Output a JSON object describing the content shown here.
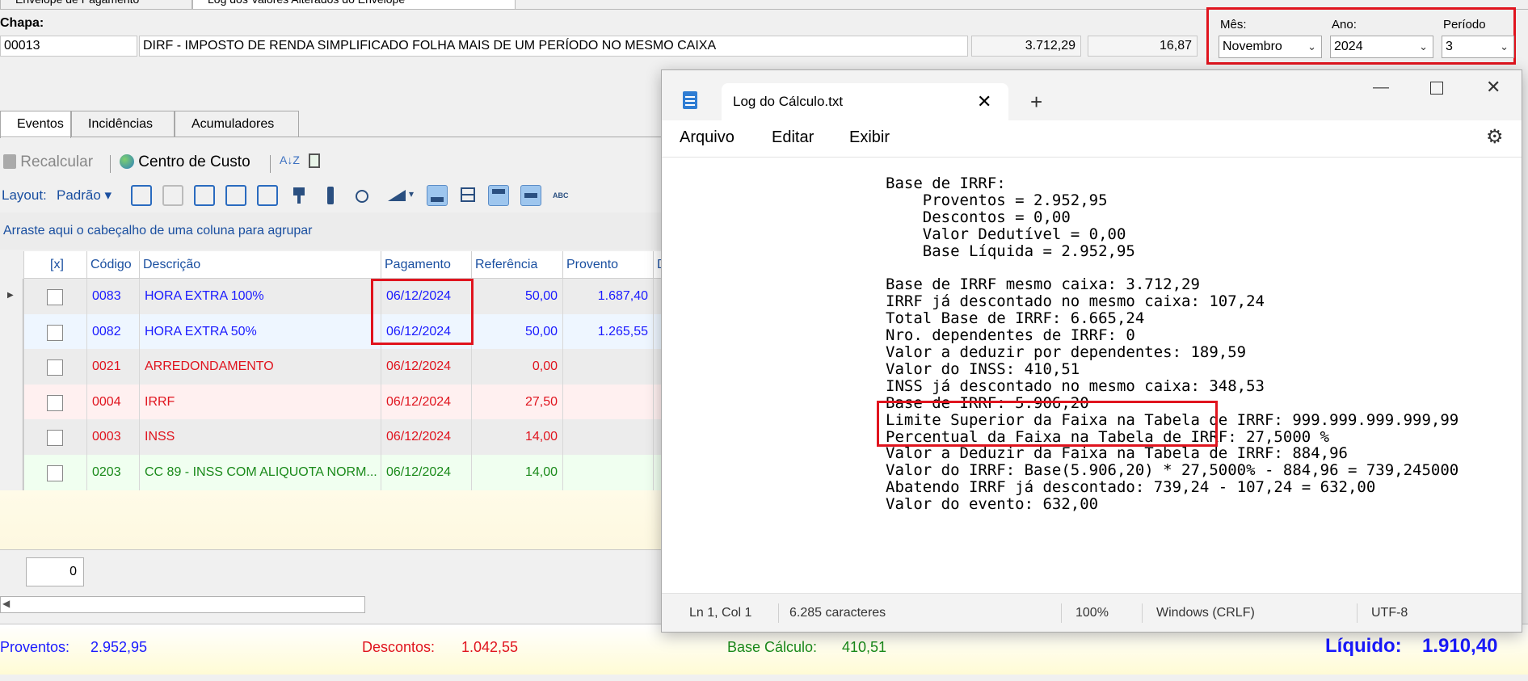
{
  "top_tabs": [
    "Envelope de Pagamento",
    "Log dos Valores Alterados do Envelope"
  ],
  "chapa": {
    "label": "Chapa:",
    "code": "00013",
    "description": "DIRF - IMPOSTO DE RENDA SIMPLIFICADO FOLHA MAIS DE UM PERÍODO NO MESMO CAIXA",
    "value1": "3.712,29",
    "value2": "16,87"
  },
  "period": {
    "mes_label": "Mês:",
    "mes_value": "Novembro",
    "ano_label": "Ano:",
    "ano_value": "2024",
    "periodo_label": "Período",
    "periodo_value": "3"
  },
  "tabs": [
    "Eventos",
    "Incidências",
    "Acumuladores"
  ],
  "toolbar": {
    "recalcular": "Recalcular",
    "centro_custo": "Centro de Custo"
  },
  "layout": {
    "label": "Layout:",
    "value": "Padrão"
  },
  "group_hint": "Arraste aqui o cabeçalho de uma coluna para agrupar",
  "grid": {
    "headers": [
      "[x]",
      "Código",
      "Descrição",
      "Pagamento",
      "Referência",
      "Provento",
      "D"
    ],
    "rows": [
      {
        "codigo": "0083",
        "descricao": "HORA EXTRA 100%",
        "pagamento": "06/12/2024",
        "referencia": "50,00",
        "provento": "1.687,40",
        "color": "#1a1aff",
        "bg": "#ececec"
      },
      {
        "codigo": "0082",
        "descricao": "HORA EXTRA 50%",
        "pagamento": "06/12/2024",
        "referencia": "50,00",
        "provento": "1.265,55",
        "color": "#1a1aff",
        "bg": "#eef6ff"
      },
      {
        "codigo": "0021",
        "descricao": "ARREDONDAMENTO",
        "pagamento": "06/12/2024",
        "referencia": "0,00",
        "provento": "",
        "color": "#e0141e",
        "bg": "#ececec"
      },
      {
        "codigo": "0004",
        "descricao": "IRRF",
        "pagamento": "06/12/2024",
        "referencia": "27,50",
        "provento": "",
        "color": "#e0141e",
        "bg": "#fff0f0"
      },
      {
        "codigo": "0003",
        "descricao": "INSS",
        "pagamento": "06/12/2024",
        "referencia": "14,00",
        "provento": "",
        "color": "#e0141e",
        "bg": "#ececec"
      },
      {
        "codigo": "0203",
        "descricao": "CC 89 - INSS COM ALIQUOTA NORM...",
        "pagamento": "06/12/2024",
        "referencia": "14,00",
        "provento": "",
        "color": "#1a8a1a",
        "bg": "#f0fff0"
      }
    ]
  },
  "count_value": "0",
  "footer": {
    "proventos_label": "Proventos:",
    "proventos_value": "2.952,95",
    "descontos_label": "Descontos:",
    "descontos_value": "1.042,55",
    "base_label": "Base Cálculo:",
    "base_value": "410,51",
    "liquido_label": "Líquido:",
    "liquido_value": "1.910,40"
  },
  "notepad": {
    "tab_title": "Log do Cálculo.txt",
    "menu": [
      "Arquivo",
      "Editar",
      "Exibir"
    ],
    "lines": [
      "Base de IRRF:",
      "    Proventos = 2.952,95",
      "    Descontos = 0,00",
      "    Valor Dedutível = 0,00",
      "    Base Líquida = 2.952,95",
      "",
      "Base de IRRF mesmo caixa: 3.712,29",
      "IRRF já descontado no mesmo caixa: 107,24",
      "Total Base de IRRF: 6.665,24",
      "Nro. dependentes de IRRF: 0",
      "Valor a deduzir por dependentes: 189,59",
      "Valor do INSS: 410,51",
      "INSS já descontado no mesmo caixa: 348,53",
      "Base de IRRF: 5.906,20",
      "Limite Superior da Faixa na Tabela de IRRF: 999.999.999.999,99",
      "Percentual da Faixa na Tabela de IRRF: 27,5000 %",
      "Valor a Deduzir da Faixa na Tabela de IRRF: 884,96",
      "Valor do IRRF: Base(5.906,20) * 27,5000% - 884,96 = 739,245000",
      "Abatendo IRRF já descontado: 739,24 - 107,24 = 632,00",
      "Valor do evento: 632,00"
    ],
    "status": {
      "position": "Ln 1, Col 1",
      "chars": "6.285 caracteres",
      "zoom": "100%",
      "eol": "Windows (CRLF)",
      "encoding": "UTF-8"
    }
  }
}
